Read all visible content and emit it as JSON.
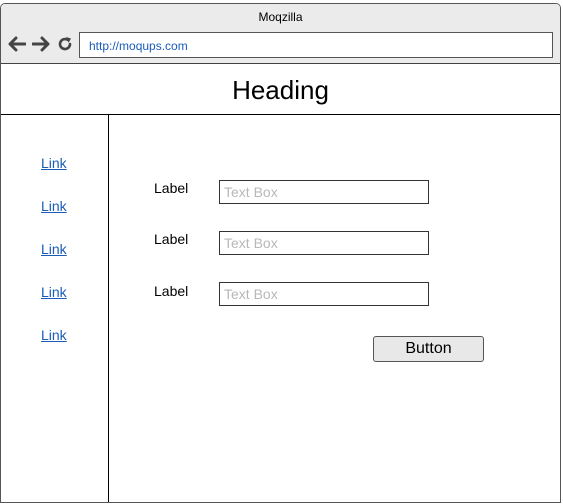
{
  "browser": {
    "title": "Moqzilla",
    "url": "http://moqups.com",
    "back_icon": "arrow-left-icon",
    "forward_icon": "arrow-right-icon",
    "reload_icon": "reload-icon"
  },
  "page": {
    "heading": "Heading",
    "sidebar": {
      "links": [
        "Link",
        "Link",
        "Link",
        "Link",
        "Link"
      ]
    },
    "form": {
      "fields": [
        {
          "label": "Label",
          "placeholder": "Text Box",
          "value": ""
        },
        {
          "label": "Label",
          "placeholder": "Text Box",
          "value": ""
        },
        {
          "label": "Label",
          "placeholder": "Text Box",
          "value": ""
        }
      ],
      "button_label": "Button"
    }
  }
}
